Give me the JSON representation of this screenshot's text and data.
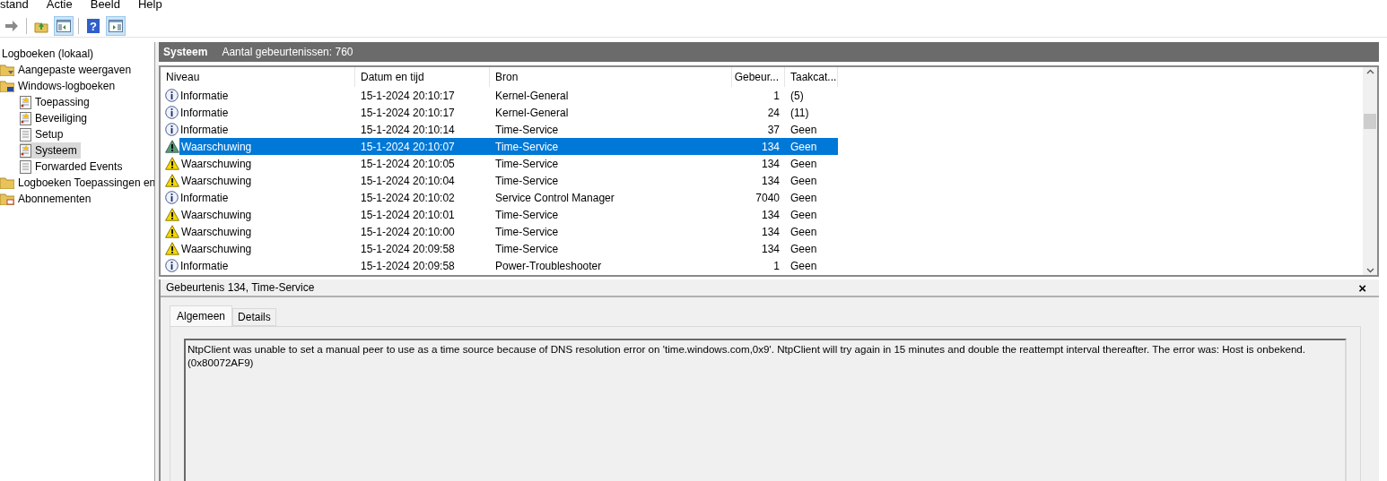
{
  "menu": [
    "stand",
    "Actie",
    "Beeld",
    "Help"
  ],
  "toolbar": [
    {
      "kind": "forward",
      "pressed": false
    },
    {
      "kind": "separator"
    },
    {
      "kind": "folder-up",
      "pressed": false
    },
    {
      "kind": "pane",
      "pressed": true
    },
    {
      "kind": "separator"
    },
    {
      "kind": "help",
      "pressed": false,
      "glyph": "?"
    },
    {
      "kind": "pane-right",
      "pressed": true
    }
  ],
  "tree": {
    "label": "Logboeken (lokaal)",
    "children": [
      {
        "label": "Aangepaste weergaven",
        "kind": "filter-folder",
        "selected": false
      },
      {
        "label": "Windows-logboeken",
        "kind": "computer-folder",
        "selected": false,
        "children": [
          {
            "label": "Toepassing",
            "kind": "log",
            "selected": false
          },
          {
            "label": "Beveiliging",
            "kind": "log",
            "selected": false
          },
          {
            "label": "Setup",
            "kind": "plain-log",
            "selected": false
          },
          {
            "label": "Systeem",
            "kind": "log",
            "selected": true
          },
          {
            "label": "Forwarded Events",
            "kind": "plain-log",
            "selected": false
          }
        ]
      },
      {
        "label": "Logboeken Toepassingen en",
        "kind": "folder",
        "selected": false
      },
      {
        "label": "Abonnementen",
        "kind": "sub-folder",
        "selected": false
      }
    ]
  },
  "panel_title": "Systeem",
  "panel_count": "Aantal gebeurtenissen: 760",
  "table": {
    "columns": [
      "Niveau",
      "Datum en tijd",
      "Bron",
      "Gebeur...",
      "Taakcat..."
    ],
    "rows": [
      {
        "kind": "info",
        "level": "Informatie",
        "date": "15-1-2024 20:10:17",
        "source": "Kernel-General",
        "id": "1",
        "task": "(5)",
        "selected": false
      },
      {
        "kind": "info",
        "level": "Informatie",
        "date": "15-1-2024 20:10:17",
        "source": "Kernel-General",
        "id": "24",
        "task": "(11)",
        "selected": false
      },
      {
        "kind": "info",
        "level": "Informatie",
        "date": "15-1-2024 20:10:14",
        "source": "Time-Service",
        "id": "37",
        "task": "Geen",
        "selected": false
      },
      {
        "kind": "warning",
        "level": "Waarschuwing",
        "date": "15-1-2024 20:10:07",
        "source": "Time-Service",
        "id": "134",
        "task": "Geen",
        "selected": true
      },
      {
        "kind": "warning",
        "level": "Waarschuwing",
        "date": "15-1-2024 20:10:05",
        "source": "Time-Service",
        "id": "134",
        "task": "Geen",
        "selected": false
      },
      {
        "kind": "warning",
        "level": "Waarschuwing",
        "date": "15-1-2024 20:10:04",
        "source": "Time-Service",
        "id": "134",
        "task": "Geen",
        "selected": false
      },
      {
        "kind": "info",
        "level": "Informatie",
        "date": "15-1-2024 20:10:02",
        "source": "Service Control Manager",
        "id": "7040",
        "task": "Geen",
        "selected": false
      },
      {
        "kind": "warning",
        "level": "Waarschuwing",
        "date": "15-1-2024 20:10:01",
        "source": "Time-Service",
        "id": "134",
        "task": "Geen",
        "selected": false
      },
      {
        "kind": "warning",
        "level": "Waarschuwing",
        "date": "15-1-2024 20:10:00",
        "source": "Time-Service",
        "id": "134",
        "task": "Geen",
        "selected": false
      },
      {
        "kind": "warning",
        "level": "Waarschuwing",
        "date": "15-1-2024 20:09:58",
        "source": "Time-Service",
        "id": "134",
        "task": "Geen",
        "selected": false
      },
      {
        "kind": "info",
        "level": "Informatie",
        "date": "15-1-2024 20:09:58",
        "source": "Power-Troubleshooter",
        "id": "1",
        "task": "Geen",
        "selected": false
      }
    ]
  },
  "detail": {
    "title": "Gebeurtenis 134, Time-Service",
    "close": "×",
    "tabs": [
      {
        "label": "Algemeen",
        "selected": true
      },
      {
        "label": "Details",
        "selected": false
      }
    ],
    "message": "NtpClient was unable to set a manual peer to use as a time source because of DNS resolution error on 'time.windows.com,0x9'. NtpClient will try again in 15 minutes and double the reattempt interval thereafter. The error was: Host is onbekend. (0x80072AF9)"
  }
}
